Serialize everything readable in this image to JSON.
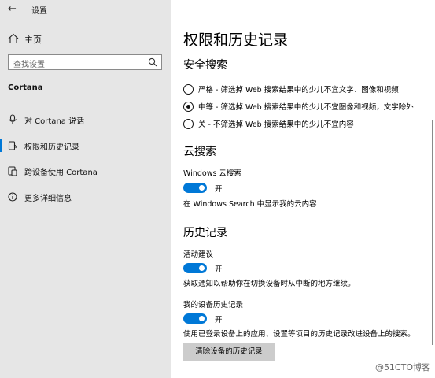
{
  "window": {
    "title": "设置"
  },
  "sidebar": {
    "home_label": "主页",
    "search_placeholder": "查找设置",
    "section": "Cortana",
    "items": [
      {
        "label": "对 Cortana 说话",
        "icon": "microphone-icon"
      },
      {
        "label": "权限和历史记录",
        "icon": "permissions-icon",
        "selected": true
      },
      {
        "label": "跨设备使用 Cortana",
        "icon": "devices-icon"
      },
      {
        "label": "更多详细信息",
        "icon": "info-icon"
      }
    ]
  },
  "main": {
    "title": "权限和历史记录",
    "safe_search": {
      "heading": "安全搜索",
      "options": [
        {
          "label": "严格 - 筛选掉 Web 搜索结果中的少儿不宜文字、图像和视频",
          "checked": false
        },
        {
          "label": "中等 - 筛选掉 Web 搜索结果中的少儿不宜图像和视频，文字除外",
          "checked": true
        },
        {
          "label": "关 - 不筛选掉 Web 搜索结果中的少儿不宜内容",
          "checked": false
        }
      ]
    },
    "cloud_search": {
      "heading": "云搜索",
      "setting_label": "Windows 云搜索",
      "toggle_state": "开",
      "description": "在 Windows Search 中显示我的云内容"
    },
    "history": {
      "heading": "历史记录",
      "activity": {
        "label": "活动建议",
        "toggle_state": "开",
        "description": "获取通知以帮助你在切换设备时从中断的地方继续。"
      },
      "device_history": {
        "label": "我的设备历史记录",
        "toggle_state": "开",
        "description": "使用已登录设备上的应用、设置等项目的历史记录改进设备上的搜索。"
      },
      "clear_button": "清除设备的历史记录"
    }
  },
  "watermark": "@51CTO博客",
  "colors": {
    "accent": "#0078d7",
    "sidebar_bg": "#e6e6e6"
  }
}
